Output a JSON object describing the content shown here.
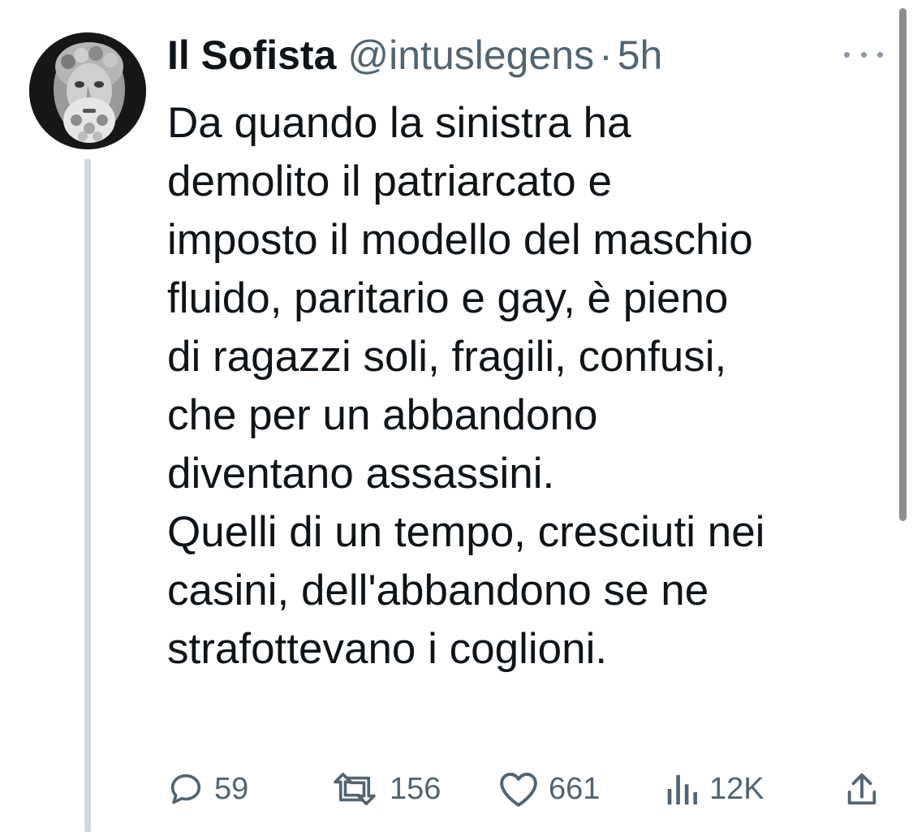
{
  "tweet": {
    "author_name": "Il Sofista",
    "author_handle": "@intuslegens",
    "separator": "·",
    "timestamp": "5h",
    "text_lines": [
      "Da quando la sinistra ha",
      "demolito il patriarcato e",
      "imposto il modello del maschio",
      "fluido, paritario e gay, è pieno",
      "di ragazzi soli, fragili, confusi,",
      "che per un abbandono",
      "diventano assassini.",
      "Quelli di un tempo, cresciuti nei",
      "casini, dell'abbandono se ne",
      "strafottevano i coglioni."
    ]
  },
  "actions": {
    "replies": {
      "icon": "reply-icon",
      "count": "59"
    },
    "retweets": {
      "icon": "retweet-icon",
      "count": "156"
    },
    "likes": {
      "icon": "heart-icon",
      "count": "661"
    },
    "views": {
      "icon": "views-icon",
      "count": "12K"
    },
    "share": {
      "icon": "share-icon"
    }
  },
  "colors": {
    "text": "#0f1419",
    "secondary": "#536471",
    "thread_line": "#cfd9de",
    "background": "#ffffff"
  }
}
